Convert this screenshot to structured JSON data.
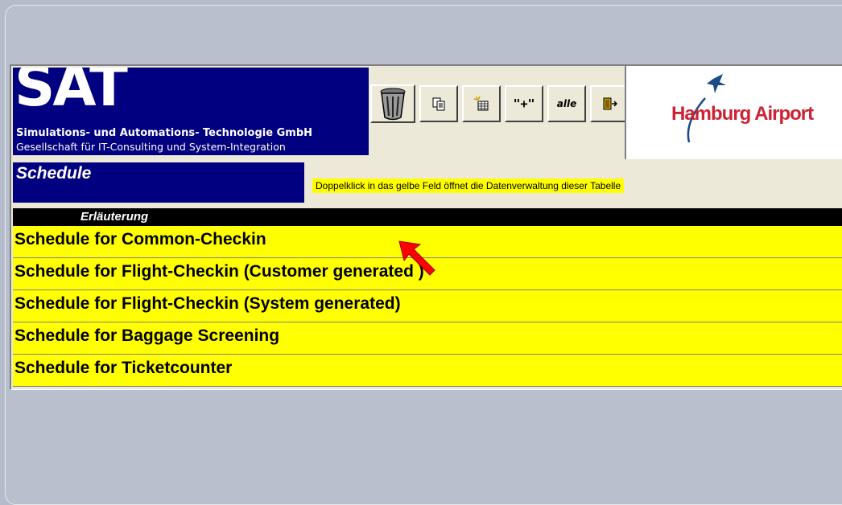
{
  "header": {
    "sat_title": "SAT",
    "sat_line1": "Simulations- und Automations- Technologie GmbH",
    "sat_line2": "Gesellschaft für IT-Consulting und System-Integration",
    "airport_logo": "Hamburg Airport"
  },
  "toolbar": {
    "delete_icon": "trash-can-icon",
    "copy_icon": "copy-icon",
    "new_record_icon": "new-record-icon",
    "add_label": "\"+\"",
    "all_label": "alle",
    "exit_icon": "exit-door-icon"
  },
  "form": {
    "title": "Schedule",
    "hint": "Doppelklick in das gelbe Feld öffnet die Datenverwaltung dieser Tabelle",
    "column_header": "Erläuterung",
    "rows": [
      "Schedule for Common-Checkin",
      "Schedule for Flight-Checkin (Customer generated )",
      "Schedule for Flight-Checkin (System generated)",
      "Schedule for Baggage Screening",
      "Schedule for Ticketcounter"
    ]
  },
  "colors": {
    "navy": "#000080",
    "row_yellow": "#ffff00",
    "airport_red": "#cc2233",
    "airport_blue": "#1a4a8a"
  }
}
